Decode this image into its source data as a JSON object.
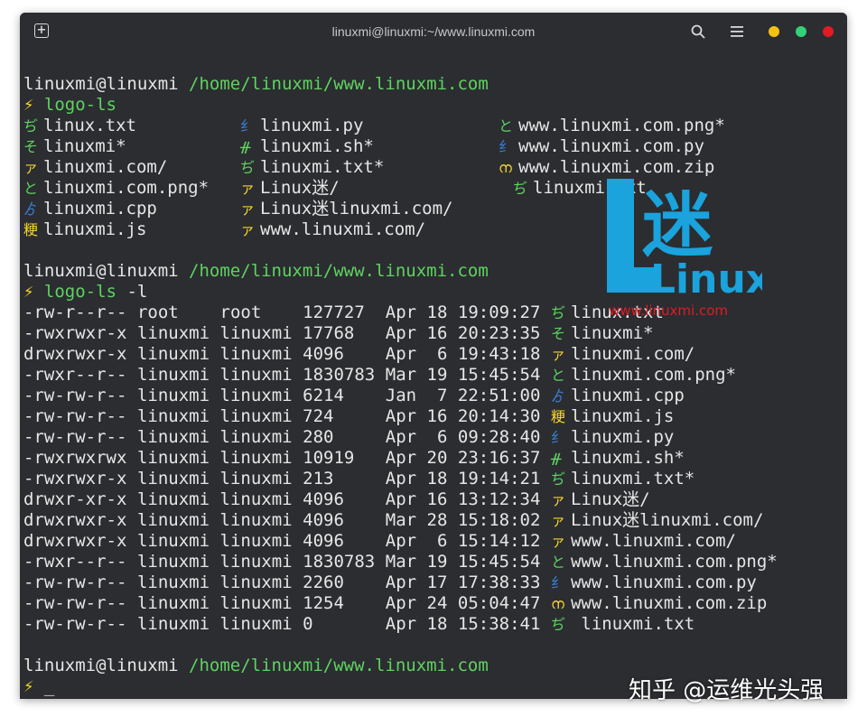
{
  "window": {
    "title": "linuxmi@linuxmi:~/www.linuxmi.com",
    "colors": {
      "bg": "#2b2d31",
      "path_green": "#5fd35f",
      "cursor_yellow": "#f6d32d",
      "min": "#f5c211",
      "max": "#33d17a",
      "close": "#e01b24"
    }
  },
  "prompt": {
    "user_host": "linuxmi@linuxmi",
    "path": "/home/linuxmi/www.linuxmi.com",
    "symbol": "⚡",
    "cmd1": "logo-ls",
    "cmd2_name": "logo-ls",
    "cmd2_flag": "-l",
    "cursor": "_"
  },
  "grid": [
    [
      {
        "icon": "ぢ",
        "color": "#5fd35f",
        "name": "linux.txt"
      },
      {
        "icon": "纟",
        "color": "#3b7fd1",
        "name": "linuxmi.py"
      },
      {
        "icon": "と",
        "color": "#5fd35f",
        "name": "www.linuxmi.com.png*"
      }
    ],
    [
      {
        "icon": "そ",
        "color": "#5fd35f",
        "name": "linuxmi*"
      },
      {
        "icon": "ᚌ",
        "color": "#5fd35f",
        "name": "linuxmi.sh*"
      },
      {
        "icon": "纟",
        "color": "#3b7fd1",
        "name": "www.linuxmi.com.py"
      }
    ],
    [
      {
        "icon": "ァ",
        "color": "#f6d32d",
        "name": "linuxmi.com/"
      },
      {
        "icon": "ぢ",
        "color": "#5fd35f",
        "name": "linuxmi.txt*"
      },
      {
        "icon": "ന",
        "color": "#f6d32d",
        "name": "www.linuxmi.com.zip"
      }
    ],
    [
      {
        "icon": "と",
        "color": "#5fd35f",
        "name": "linuxmi.com.png*"
      },
      {
        "icon": "ァ",
        "color": "#f6d32d",
        "name": "Linux迷/"
      },
      {
        "icon": "ぢ",
        "color": "#5fd35f",
        "name": "linuxmi.txt"
      }
    ],
    [
      {
        "icon": "ゟ",
        "color": "#3b7fd1",
        "name": "linuxmi.cpp"
      },
      {
        "icon": "ァ",
        "color": "#f6d32d",
        "name": "Linux迷linuxmi.com/"
      },
      {
        "icon": "",
        "color": "#5fd35f",
        "name": ""
      }
    ],
    [
      {
        "icon": "粳",
        "color": "#f6d32d",
        "name": "linuxmi.js"
      },
      {
        "icon": "ァ",
        "color": "#f6d32d",
        "name": "www.linuxmi.com/"
      },
      {
        "icon": "",
        "color": "#5fd35f",
        "name": ""
      }
    ]
  ],
  "long_list": [
    {
      "perm": "-rw-r--r--",
      "owner": "root",
      "group": "root",
      "size": "127727",
      "month": "Apr",
      "day": "18",
      "time": "19:09:27",
      "icon": "ぢ",
      "color": "#5fd35f",
      "name": "linux.txt"
    },
    {
      "perm": "-rwxrwxr-x",
      "owner": "linuxmi",
      "group": "linuxmi",
      "size": "17768",
      "month": "Apr",
      "day": "16",
      "time": "20:23:35",
      "icon": "そ",
      "color": "#5fd35f",
      "name": "linuxmi*"
    },
    {
      "perm": "drwxrwxr-x",
      "owner": "linuxmi",
      "group": "linuxmi",
      "size": "4096",
      "month": "Apr",
      "day": "6",
      "time": "19:43:18",
      "icon": "ァ",
      "color": "#f6d32d",
      "name": "linuxmi.com/"
    },
    {
      "perm": "-rwxr--r--",
      "owner": "linuxmi",
      "group": "linuxmi",
      "size": "1830783",
      "month": "Mar",
      "day": "19",
      "time": "15:45:54",
      "icon": "と",
      "color": "#5fd35f",
      "name": "linuxmi.com.png*"
    },
    {
      "perm": "-rw-rw-r--",
      "owner": "linuxmi",
      "group": "linuxmi",
      "size": "6214",
      "month": "Jan",
      "day": "7",
      "time": "22:51:00",
      "icon": "ゟ",
      "color": "#3b7fd1",
      "name": "linuxmi.cpp"
    },
    {
      "perm": "-rw-rw-r--",
      "owner": "linuxmi",
      "group": "linuxmi",
      "size": "724",
      "month": "Apr",
      "day": "16",
      "time": "20:14:30",
      "icon": "粳",
      "color": "#f6d32d",
      "name": "linuxmi.js"
    },
    {
      "perm": "-rw-rw-r--",
      "owner": "linuxmi",
      "group": "linuxmi",
      "size": "280",
      "month": "Apr",
      "day": "6",
      "time": "09:28:40",
      "icon": "纟",
      "color": "#3b7fd1",
      "name": "linuxmi.py"
    },
    {
      "perm": "-rwxrwxrwx",
      "owner": "linuxmi",
      "group": "linuxmi",
      "size": "10919",
      "month": "Apr",
      "day": "20",
      "time": "23:16:37",
      "icon": "ᚌ",
      "color": "#5fd35f",
      "name": "linuxmi.sh*"
    },
    {
      "perm": "-rwxrwxr-x",
      "owner": "linuxmi",
      "group": "linuxmi",
      "size": "213",
      "month": "Apr",
      "day": "18",
      "time": "19:14:21",
      "icon": "ぢ",
      "color": "#5fd35f",
      "name": "linuxmi.txt*"
    },
    {
      "perm": "drwxr-xr-x",
      "owner": "linuxmi",
      "group": "linuxmi",
      "size": "4096",
      "month": "Apr",
      "day": "16",
      "time": "13:12:34",
      "icon": "ァ",
      "color": "#f6d32d",
      "name": "Linux迷/"
    },
    {
      "perm": "drwxrwxr-x",
      "owner": "linuxmi",
      "group": "linuxmi",
      "size": "4096",
      "month": "Mar",
      "day": "28",
      "time": "15:18:02",
      "icon": "ァ",
      "color": "#f6d32d",
      "name": "Linux迷linuxmi.com/"
    },
    {
      "perm": "drwxrwxr-x",
      "owner": "linuxmi",
      "group": "linuxmi",
      "size": "4096",
      "month": "Apr",
      "day": "6",
      "time": "15:14:12",
      "icon": "ァ",
      "color": "#f6d32d",
      "name": "www.linuxmi.com/"
    },
    {
      "perm": "-rwxr--r--",
      "owner": "linuxmi",
      "group": "linuxmi",
      "size": "1830783",
      "month": "Mar",
      "day": "19",
      "time": "15:45:54",
      "icon": "と",
      "color": "#5fd35f",
      "name": "www.linuxmi.com.png*"
    },
    {
      "perm": "-rw-rw-r--",
      "owner": "linuxmi",
      "group": "linuxmi",
      "size": "2260",
      "month": "Apr",
      "day": "17",
      "time": "17:38:33",
      "icon": "纟",
      "color": "#3b7fd1",
      "name": "www.linuxmi.com.py"
    },
    {
      "perm": "-rw-rw-r--",
      "owner": "linuxmi",
      "group": "linuxmi",
      "size": "1254",
      "month": "Apr",
      "day": "24",
      "time": "05:04:47",
      "icon": "ന",
      "color": "#f6d32d",
      "name": "www.linuxmi.com.zip"
    },
    {
      "perm": "-rw-rw-r--",
      "owner": "linuxmi",
      "group": "linuxmi",
      "size": "0",
      "month": "Apr",
      "day": "18",
      "time": "15:38:41",
      "icon": "ぢ",
      "color": "#5fd35f",
      "name": " linuxmi.txt"
    }
  ],
  "overlay": {
    "logo_mark": "迷",
    "logo_text": "Linux",
    "logo_url": "www.linuxmi.com",
    "watermark": "知乎 @运维光头强"
  }
}
